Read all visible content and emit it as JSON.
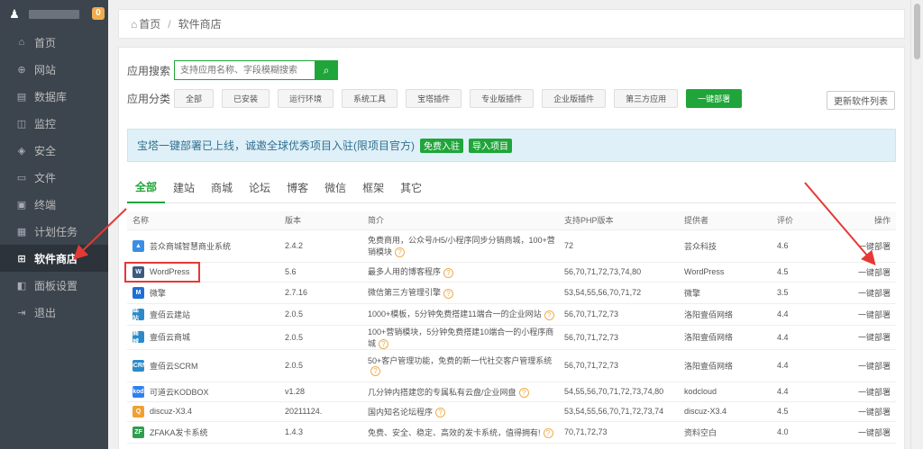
{
  "sidebar": {
    "badge": "0",
    "items": [
      {
        "label": "首页",
        "icon": "home-icon",
        "glyph": "⌂"
      },
      {
        "label": "网站",
        "icon": "globe-icon",
        "glyph": "⊕"
      },
      {
        "label": "数据库",
        "icon": "database-icon",
        "glyph": "▤"
      },
      {
        "label": "监控",
        "icon": "monitor-icon",
        "glyph": "◫"
      },
      {
        "label": "安全",
        "icon": "shield-icon",
        "glyph": "◈"
      },
      {
        "label": "文件",
        "icon": "folder-icon",
        "glyph": "▭"
      },
      {
        "label": "终端",
        "icon": "terminal-icon",
        "glyph": "▣"
      },
      {
        "label": "计划任务",
        "icon": "calendar-icon",
        "glyph": "▦"
      },
      {
        "label": "软件商店",
        "icon": "grid-icon",
        "glyph": "⊞"
      },
      {
        "label": "面板设置",
        "icon": "settings-icon",
        "glyph": "◧"
      },
      {
        "label": "退出",
        "icon": "logout-icon",
        "glyph": "⇥"
      }
    ]
  },
  "breadcrumb": {
    "home": "首页",
    "sep": "/",
    "current": "软件商店"
  },
  "search": {
    "label": "应用搜索",
    "placeholder": "支持应用名称、字段模糊搜索"
  },
  "categories": {
    "label": "应用分类",
    "items": [
      "全部",
      "已安装",
      "运行环境",
      "系统工具",
      "宝塔插件",
      "专业版插件",
      "企业版插件",
      "第三方应用",
      "一键部署"
    ],
    "active_index": 8,
    "update_label": "更新软件列表"
  },
  "notice": {
    "text": "宝塔一键部署已上线，诚邀全球优秀项目入驻(限项目官方)",
    "btn1": "免费入驻",
    "btn2": "导入项目"
  },
  "tabs": {
    "items": [
      "全部",
      "建站",
      "商城",
      "论坛",
      "博客",
      "微信",
      "框架",
      "其它"
    ],
    "active_index": 0
  },
  "table": {
    "headers": [
      "名称",
      "版本",
      "简介",
      "支持PHP版本",
      "提供者",
      "评价",
      "操作"
    ],
    "rows": [
      {
        "name": "芸众商城智慧商业系统",
        "icon_color": "#3a8ee6",
        "icon_text": "▲",
        "version": "2.4.2",
        "desc": "免费商用，公众号/H5/小程序同步分销商城，100+营销模块",
        "q": true,
        "php": "72",
        "provider": "芸众科技",
        "score": "4.6",
        "action": "一键部署",
        "h": 36
      },
      {
        "name": "WordPress",
        "icon_color": "#3d5a80",
        "icon_text": "W",
        "version": "5.6",
        "desc": "最多人用的博客程序",
        "q": true,
        "php": "56,70,71,72,73,74,80",
        "provider": "WordPress",
        "score": "4.5",
        "action": "一键部署",
        "h": 22
      },
      {
        "name": "微擎",
        "icon_color": "#1e6fd6",
        "icon_text": "M",
        "version": "2.7.16",
        "desc": "微信第三方管理引擎",
        "q": true,
        "php": "53,54,55,56,70,71,72",
        "provider": "微擎",
        "score": "3.5",
        "action": "一键部署",
        "h": 24
      },
      {
        "name": "壹佰云建站",
        "icon_color": "#2b8ac9",
        "icon_text": "建站",
        "version": "2.0.5",
        "desc": "1000+模板，5分钟免费搭建11端合一的企业网站",
        "q": true,
        "php": "56,70,71,72,73",
        "provider": "洛阳壹佰网络",
        "score": "4.4",
        "action": "一键部署",
        "h": 24
      },
      {
        "name": "壹佰云商城",
        "icon_color": "#2b8ac9",
        "icon_text": "商城",
        "version": "2.0.5",
        "desc": "100+营销模块，5分钟免费搭建10端合一的小程序商城",
        "q": true,
        "php": "56,70,71,72,73",
        "provider": "洛阳壹佰网络",
        "score": "4.4",
        "action": "一键部署",
        "h": 22
      },
      {
        "name": "壹佰云SCRM",
        "icon_color": "#2b8ac9",
        "icon_text": "SCRM",
        "version": "2.0.5",
        "desc": "50+客户管理功能，免费的新一代社交客户管理系统",
        "q": true,
        "php": "56,70,71,72,73",
        "provider": "洛阳壹佰网络",
        "score": "4.4",
        "action": "一键部署",
        "h": 36
      },
      {
        "name": "可道云KODBOX",
        "icon_color": "#2f80ed",
        "icon_text": "kod",
        "version": "v1.28",
        "desc": "几分钟内搭建您的专属私有云盘/企业网盘",
        "q": true,
        "php": "54,55,56,70,71,72,73,74,80",
        "provider": "kodcloud",
        "score": "4.4",
        "action": "一键部署",
        "h": 22
      },
      {
        "name": "discuz-X3.4",
        "icon_color": "#f0a030",
        "icon_text": "Q",
        "version": "20211124.",
        "desc": "国内知名论坛程序",
        "q": true,
        "php": "53,54,55,56,70,71,72,73,74",
        "provider": "discuz-X3.4",
        "score": "4.5",
        "action": "一键部署",
        "h": 22
      },
      {
        "name": "ZFAKA发卡系统",
        "icon_color": "#2e9e4f",
        "icon_text": "ZF",
        "version": "1.4.3",
        "desc": "免费、安全、稳定、高效的发卡系统，值得拥有!",
        "q": true,
        "php": "70,71,72,73",
        "provider": "资料空白",
        "score": "4.0",
        "action": "一键部署",
        "h": 24
      }
    ]
  },
  "colors": {
    "accent": "#20a53a",
    "sidebar": "#3c444d",
    "annotation": "#e53935"
  }
}
